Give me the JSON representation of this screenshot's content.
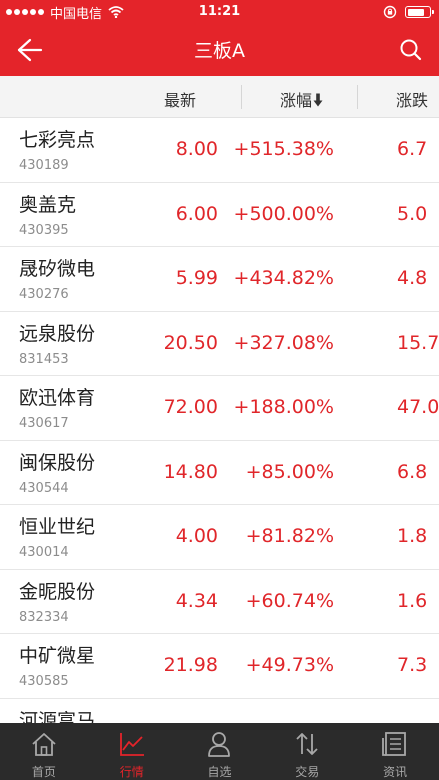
{
  "status_bar": {
    "carrier": "中国电信",
    "time": "11:21"
  },
  "header": {
    "title": "三板A",
    "background_color": "#e4242a"
  },
  "columns": {
    "latest": "最新",
    "change_pct": "涨幅",
    "change_amount": "涨跌"
  },
  "stocks": [
    {
      "name": "七彩亮点",
      "code": "430189",
      "price": "8.00",
      "change_pct": "+515.38%",
      "change_amount": "6.7"
    },
    {
      "name": "奥盖克",
      "code": "430395",
      "price": "6.00",
      "change_pct": "+500.00%",
      "change_amount": "5.0"
    },
    {
      "name": "晟矽微电",
      "code": "430276",
      "price": "5.99",
      "change_pct": "+434.82%",
      "change_amount": "4.8"
    },
    {
      "name": "远泉股份",
      "code": "831453",
      "price": "20.50",
      "change_pct": "+327.08%",
      "change_amount": "15.7"
    },
    {
      "name": "欧迅体育",
      "code": "430617",
      "price": "72.00",
      "change_pct": "+188.00%",
      "change_amount": "47.0"
    },
    {
      "name": "闽保股份",
      "code": "430544",
      "price": "14.80",
      "change_pct": "+85.00%",
      "change_amount": "6.8"
    },
    {
      "name": "恒业世纪",
      "code": "430014",
      "price": "4.00",
      "change_pct": "+81.82%",
      "change_amount": "1.8"
    },
    {
      "name": "金昵股份",
      "code": "832334",
      "price": "4.34",
      "change_pct": "+60.74%",
      "change_amount": "1.6"
    },
    {
      "name": "中矿微星",
      "code": "430585",
      "price": "21.98",
      "change_pct": "+49.73%",
      "change_amount": "7.3"
    },
    {
      "name": "河源富马",
      "code": "",
      "price": "",
      "change_pct": "",
      "change_amount": ""
    }
  ],
  "tabbar": {
    "items": [
      {
        "label": "首页",
        "icon": "home-icon",
        "active": false
      },
      {
        "label": "行情",
        "icon": "market-chart-icon",
        "active": true
      },
      {
        "label": "自选",
        "icon": "person-icon",
        "active": false
      },
      {
        "label": "交易",
        "icon": "trade-arrows-icon",
        "active": false
      },
      {
        "label": "资讯",
        "icon": "news-icon",
        "active": false
      }
    ],
    "active_color": "#e4242a",
    "inactive_color": "#a8a8a8"
  }
}
